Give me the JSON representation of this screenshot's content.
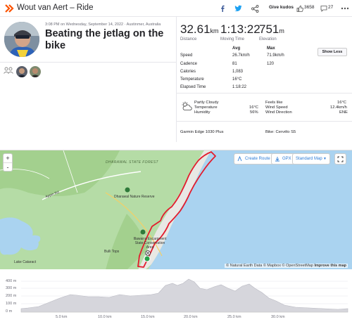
{
  "header": {
    "title": "Wout van Aert – Ride",
    "kudos_label": "Give kudos",
    "kudos_count": "3658",
    "comment_count": "27",
    "brand_color": "#fc5200"
  },
  "activity": {
    "datetime": "3:08 PM on Wednesday, September 14, 2022 · Austinmer, Australia",
    "title": "Beating the jetlag on the bike"
  },
  "summary": {
    "distance_value": "32.61",
    "distance_unit": "km",
    "distance_label": "Distance",
    "moving_time_value": "1:13:22",
    "moving_time_label": "Moving Time",
    "elevation_value": "751",
    "elevation_unit": "m",
    "elevation_label": "Elevation"
  },
  "stats": {
    "show_less_label": "Show Less",
    "col_avg": "Avg",
    "col_max": "Max",
    "rows": [
      {
        "label": "Speed",
        "avg": "26.7km/h",
        "max": "71.9km/h"
      },
      {
        "label": "Cadence",
        "avg": "81",
        "max": "120"
      },
      {
        "label": "Calories",
        "avg": "1,083",
        "max": ""
      },
      {
        "label": "Temperature",
        "avg": "16°C",
        "max": ""
      },
      {
        "label": "Elapsed Time",
        "avg": "1:18:22",
        "max": ""
      }
    ]
  },
  "weather": {
    "icon": "partly-cloudy-icon",
    "condition": "Partly Cloudy",
    "temperature_label": "Temperature",
    "temperature_value": "16°C",
    "humidity_label": "Humidity",
    "humidity_value": "56%",
    "feels_like_label": "Feels like",
    "feels_like_value": "16°C",
    "wind_speed_label": "Wind Speed",
    "wind_speed_value": "12.4km/h",
    "wind_direction_label": "Wind Direction",
    "wind_direction_value": "ENE"
  },
  "devices": {
    "device": "Garmin Edge 1030 Plus",
    "bike": "Bike: Cervélo S5"
  },
  "map": {
    "create_route_label": "Create Route",
    "gpx_label": "GPX",
    "map_type_label": "Standard Map",
    "zoom_in": "+",
    "zoom_out": "-",
    "attribution": "© Natural Earth Data © Mapbox © OpenStreetMap",
    "improve_label": "Improve this map",
    "labels": {
      "forest": "DHARAWAL STATE FOREST",
      "reserve": "Dharawal Nature Reserve",
      "conservation": "Illawarra Escarpment State Conservation Area",
      "road": "Appin Rd",
      "bulli": "Bulli Tops",
      "lake": "Lake Cataract"
    },
    "water_color": "#aad3f0",
    "land_color": "#b5dca6",
    "route_color": "#e31c2d"
  },
  "elevation_profile": {
    "y_ticks": [
      "400 m",
      "300 m",
      "200 m",
      "100 m",
      "0 m"
    ],
    "x_ticks": [
      "5.0 km",
      "10.0 km",
      "15.0 km",
      "20.0 km",
      "25.0 km",
      "30.0 km"
    ],
    "fill_color": "#d6d6dc"
  }
}
